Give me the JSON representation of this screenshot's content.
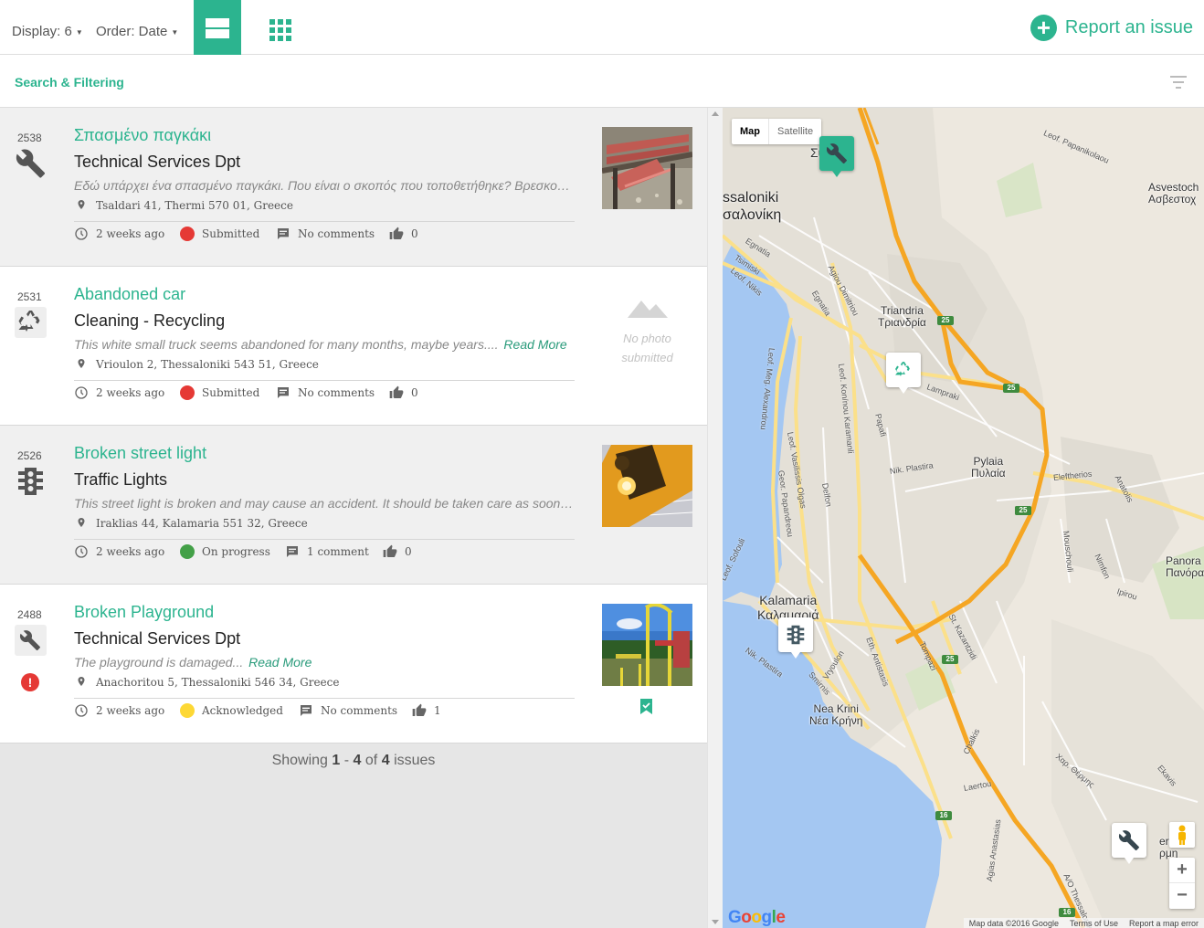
{
  "toolbar": {
    "display_label": "Display: 6",
    "order_label": "Order: Date",
    "report_label": "Report an issue",
    "accent": "#2cb48f"
  },
  "filter": {
    "label": "Search & Filtering"
  },
  "issues": [
    {
      "id": "2538",
      "title": "Σπασμένο παγκάκι",
      "department": "Technical Services Dpt",
      "category_icon": "wrench-icon",
      "description": "Εδώ υπάρχει ένα σπασμένο παγκάκι. Που είναι ο σκοπός που τοποθετήθηκε? Βρεσκοβ...",
      "read_more": "",
      "address": "Tsaldari 41, Thermi 570 01, Greece",
      "time": "2 weeks ago",
      "status": "Submitted",
      "status_color": "#e53935",
      "comments": "No comments",
      "likes": "0",
      "photo": "broken-bench-photo"
    },
    {
      "id": "2531",
      "title": "Abandoned car",
      "department": "Cleaning - Recycling",
      "category_icon": "recycling-icon",
      "description": "This white small truck seems abandoned for many months, maybe years....",
      "read_more": "Read More",
      "address": "Vrioulon 2, Thessaloniki 543 51, Greece",
      "time": "2 weeks ago",
      "status": "Submitted",
      "status_color": "#e53935",
      "comments": "No comments",
      "likes": "0",
      "no_photo_line1": "No photo",
      "no_photo_line2": "submitted"
    },
    {
      "id": "2526",
      "title": "Broken street light",
      "department": "Traffic Lights",
      "category_icon": "traffic-light-icon",
      "description": "This street light is broken and may cause an accident. It should be taken care as soon as...",
      "read_more": "",
      "address": "Iraklias 44, Kalamaria 551 32, Greece",
      "time": "2 weeks ago",
      "status": "On progress",
      "status_color": "#43a047",
      "comments": "1 comment",
      "likes": "0",
      "photo": "traffic-light-photo"
    },
    {
      "id": "2488",
      "title": "Broken Playground",
      "department": "Technical Services Dpt",
      "category_icon": "wrench-icon",
      "description": "The playground is damaged...",
      "read_more": "Read More",
      "address": "Anachoritou 5, Thessaloniki 546 34, Greece",
      "time": "2 weeks ago",
      "status": "Acknowledged",
      "status_color": "#fdd835",
      "comments": "No comments",
      "likes": "1",
      "photo": "playground-photo",
      "alert_icon": "alert-icon",
      "bookmark_icon": "bookmark-check-icon"
    }
  ],
  "pagination": {
    "prefix": "Showing",
    "from": "1",
    "dash": "-",
    "to": "4",
    "of": "of",
    "total": "4",
    "suffix": "issues"
  },
  "map": {
    "type_map": "Map",
    "type_satellite": "Satellite",
    "places": {
      "thessaloniki_en": "ssaloniki",
      "thessaloniki_gr": "σαλονίκη",
      "triandria_en": "Triandria",
      "triandria_gr": "Τριανδρία",
      "pylaia_en": "Pylaia",
      "pylaia_gr": "Πυλαία",
      "kalamaria_en": "Kalamaria",
      "kalamaria_gr": "Καλαμαριά",
      "neakrini_en": "Nea Krini",
      "neakrini_gr": "Νέα Κρήνη",
      "asvestochori_en": "Asvestoch",
      "asvestochori_gr": "Ασβεστοχ",
      "panorama_en": "Panora",
      "panorama_gr": "Πανόρα",
      "syk": "Συκ",
      "thermi_en": "ermi",
      "thermi_gr": "ρμη"
    },
    "streets": {
      "egnatia": "Egnatia",
      "tsimiski": "Tsimiski",
      "leof_nikis": "Leof. Nikis",
      "agiou_dimitriou": "Agiou Dimitriou",
      "egnatia2": "Egnatia",
      "leof_papanikolaou": "Leof. Papanikolaou",
      "lampraki": "Lampraki",
      "papafi": "Papafi",
      "leof_meg_alexandrou": "Leof. Meg. Alexandrou",
      "leof_vasilissis_olgas": "Leof. Vasilissis Olgas",
      "leof_karamanli": "Leof. Kon/nou Karamanli",
      "delfon": "Delfon",
      "nik_plastira": "Nik. Plastira",
      "georgiou_papandreou": "Geor. Papandreou",
      "eleftheriou": "Eleftherios",
      "anatolis": "Anatolis",
      "mousxouli": "Mouschouli",
      "nimfon": "Nimfon",
      "ipirou": "Ipirou",
      "sofouli": "Leof. Sofouli",
      "nik_plastira2": "Nik. Plastira",
      "smirnis": "Smirnis",
      "vryoulon": "Vryoulon",
      "eth_antistasis": "Eth. Antistasis",
      "tompazi": "Tompazi",
      "st_kazantzidi": "St. Kazantzidi",
      "chalkis": "Chalkis",
      "laertou": "Laertou",
      "char_thermis": "Χαρ. Θέρμης",
      "ekavis": "Ekavis",
      "agias_anastasias": "Agias Anastasias",
      "ao_thessalonikis": "A/O Thessalonikis"
    },
    "shields": [
      "25",
      "25",
      "25",
      "25",
      "25",
      "16",
      "16"
    ],
    "markers": [
      "wrench-icon",
      "recycling-icon",
      "traffic-light-icon",
      "wrench-icon"
    ],
    "zoom_in": "+",
    "zoom_out": "−",
    "google": "Google",
    "attribution": [
      "Map data ©2016 Google",
      "Terms of Use",
      "Report a map error"
    ]
  }
}
